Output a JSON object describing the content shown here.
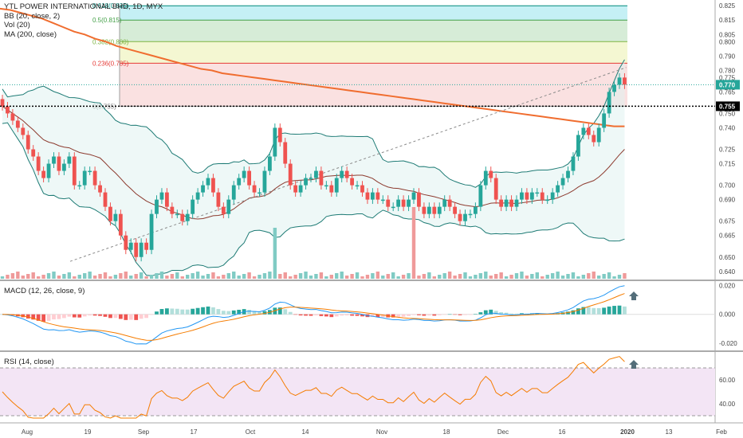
{
  "chart_data": [
    {
      "type": "candlestick",
      "title": "YTL POWER INTERNATIONAL BHD, 1D, MYX",
      "indicators": [
        "BB (20, close, 2)",
        "Vol (20)",
        "MA (200, close)"
      ],
      "y_ticks": [
        "0.825",
        "0.815",
        "0.805",
        "0.800",
        "0.790",
        "0.780",
        "0.775",
        "0.765",
        "0.755",
        "0.750",
        "0.740",
        "0.725",
        "0.715",
        "0.700",
        "0.690",
        "0.675",
        "0.665",
        "0.650",
        "0.640"
      ],
      "ylim": [
        0.636,
        0.829
      ],
      "last_price_label": "0.770",
      "level_label": "0.755",
      "fib_levels": [
        {
          "label": "0.618(0.825)",
          "value": 0.825
        },
        {
          "label": "0.5(0.815)",
          "value": 0.815
        },
        {
          "label": "0.382(0.800)",
          "value": 0.8
        },
        {
          "label": "0.236(0.785)",
          "value": 0.785
        },
        {
          "label": "0(0.755)",
          "value": 0.755
        }
      ],
      "fib_colors": [
        "#b2ebf2",
        "#c8e6c9",
        "#f0f4c3",
        "#f8d7d7"
      ],
      "up_color": "#26a69a",
      "down_color": "#ef5350",
      "ma_color": "#f06d2f",
      "bb_color": "#1e7b75",
      "closes": [
        0.755,
        0.75,
        0.745,
        0.74,
        0.735,
        0.725,
        0.72,
        0.71,
        0.705,
        0.715,
        0.72,
        0.71,
        0.715,
        0.72,
        0.7,
        0.7,
        0.71,
        0.71,
        0.7,
        0.695,
        0.685,
        0.675,
        0.68,
        0.665,
        0.655,
        0.66,
        0.65,
        0.66,
        0.655,
        0.68,
        0.69,
        0.695,
        0.685,
        0.68,
        0.68,
        0.675,
        0.68,
        0.69,
        0.695,
        0.7,
        0.705,
        0.695,
        0.685,
        0.68,
        0.69,
        0.7,
        0.705,
        0.71,
        0.7,
        0.695,
        0.695,
        0.71,
        0.72,
        0.74,
        0.73,
        0.715,
        0.7,
        0.695,
        0.7,
        0.705,
        0.705,
        0.71,
        0.7,
        0.7,
        0.695,
        0.705,
        0.71,
        0.705,
        0.7,
        0.7,
        0.695,
        0.69,
        0.695,
        0.69,
        0.69,
        0.685,
        0.685,
        0.69,
        0.685,
        0.69,
        0.695,
        0.685,
        0.68,
        0.685,
        0.68,
        0.685,
        0.69,
        0.685,
        0.68,
        0.675,
        0.68,
        0.68,
        0.685,
        0.7,
        0.71,
        0.705,
        0.69,
        0.685,
        0.69,
        0.685,
        0.69,
        0.695,
        0.69,
        0.695,
        0.695,
        0.69,
        0.69,
        0.695,
        0.7,
        0.705,
        0.71,
        0.72,
        0.735,
        0.74,
        0.735,
        0.73,
        0.74,
        0.75,
        0.765,
        0.77,
        0.775,
        0.77
      ],
      "ma200": [
        0.823,
        0.822,
        0.82,
        0.818,
        0.816,
        0.813,
        0.81,
        0.807,
        0.805,
        0.802,
        0.8,
        0.797,
        0.795,
        0.793,
        0.791,
        0.789,
        0.787,
        0.785,
        0.783,
        0.781,
        0.78,
        0.778,
        0.777,
        0.776,
        0.775,
        0.774,
        0.773,
        0.772,
        0.771,
        0.77,
        0.769,
        0.768,
        0.767,
        0.766,
        0.765,
        0.764,
        0.763,
        0.762,
        0.761,
        0.76,
        0.759,
        0.758,
        0.757,
        0.756,
        0.755,
        0.754,
        0.753,
        0.752,
        0.751,
        0.75,
        0.749,
        0.748,
        0.747,
        0.746,
        0.745,
        0.744,
        0.743,
        0.742,
        0.741,
        0.741
      ],
      "volume_spikes": [
        {
          "index": 53,
          "value": 3.2,
          "color": "#26a69a"
        },
        {
          "index": 80,
          "value": 4.5,
          "color": "#ef5350"
        }
      ]
    },
    {
      "type": "line",
      "title": "MACD (12, 26, close, 9)",
      "y_ticks": [
        "0.020",
        "0.000",
        "-0.020"
      ],
      "ylim": [
        -0.024,
        0.022
      ],
      "macd_color": "#2196f3",
      "signal_color": "#f57c00"
    },
    {
      "type": "line",
      "title": "RSI (14, close)",
      "y_ticks": [
        "60.00",
        "40.00"
      ],
      "ylim": [
        26,
        82
      ],
      "bands": [
        70,
        30
      ],
      "line_color": "#f57c00",
      "band_color": "#f3e5f5"
    }
  ],
  "x_ticks": [
    "Aug",
    "19",
    "Sep",
    "17",
    "Oct",
    "14",
    "Nov",
    "18",
    "Dec",
    "16",
    "2020",
    "13",
    "Feb"
  ]
}
